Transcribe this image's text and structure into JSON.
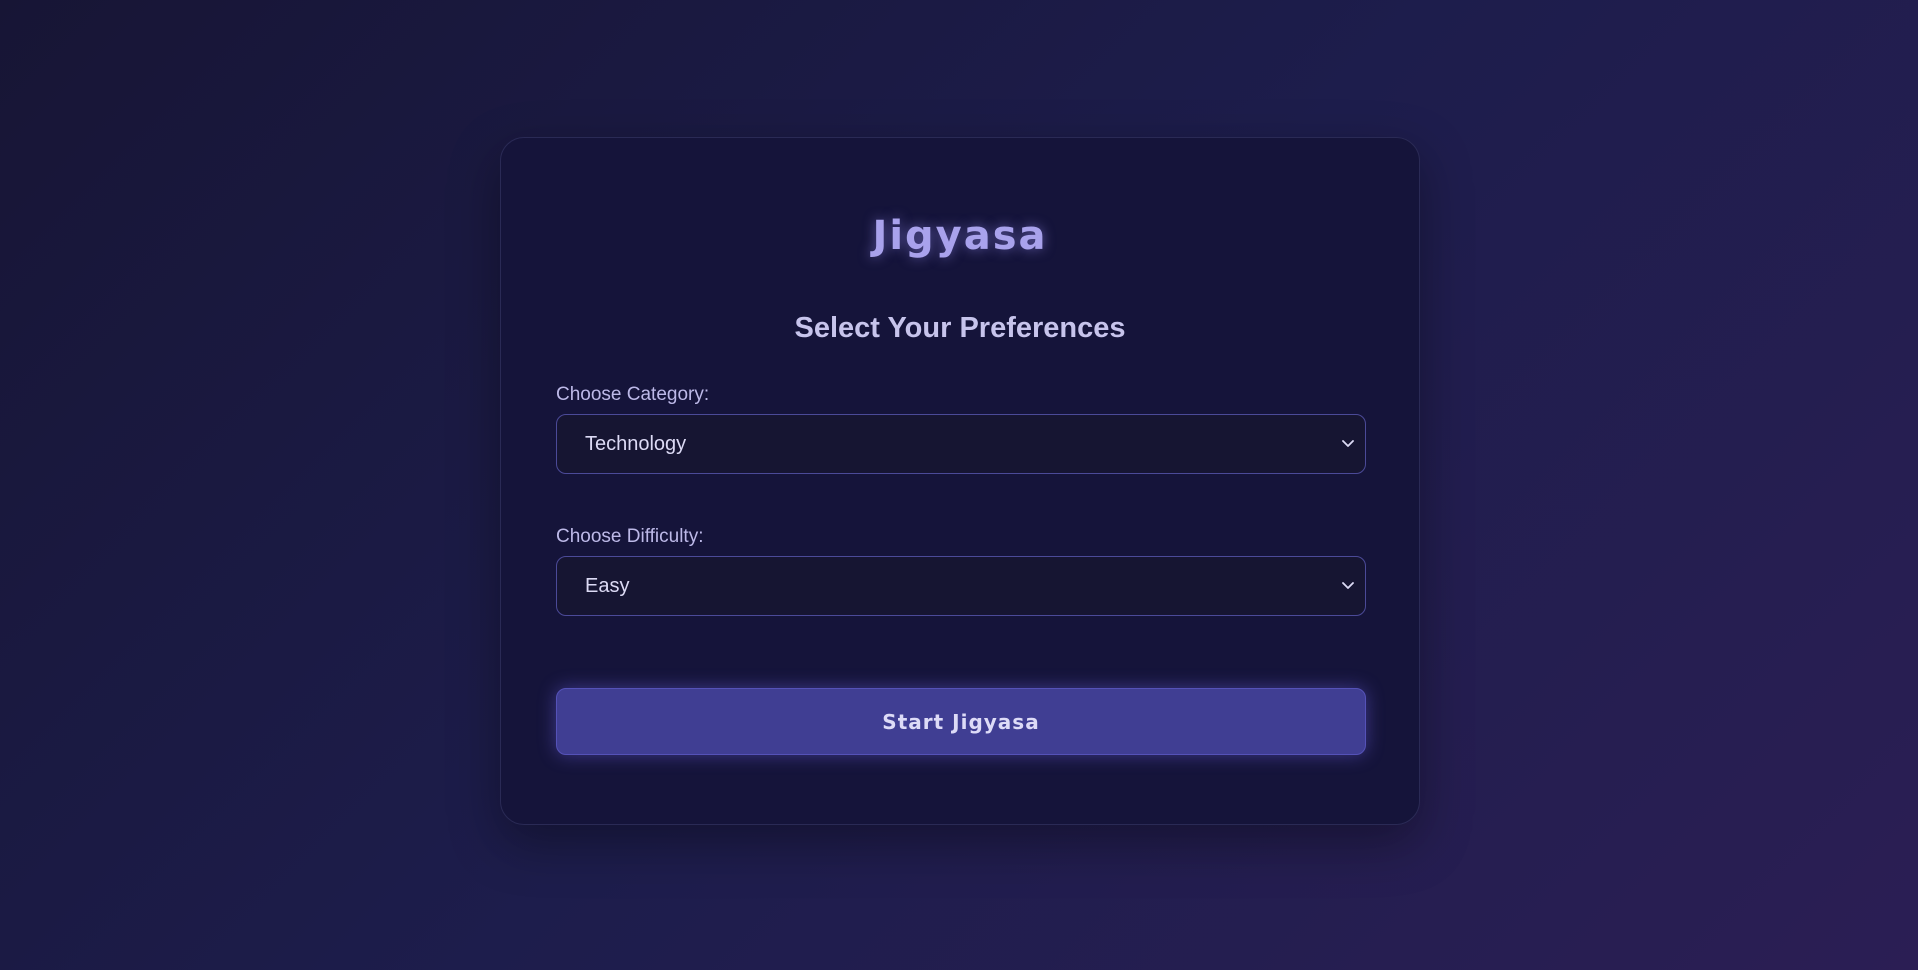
{
  "app": {
    "title": "Jigyasa"
  },
  "form": {
    "heading": "Select Your Preferences",
    "category": {
      "label": "Choose Category:",
      "selected": "Technology"
    },
    "difficulty": {
      "label": "Choose Difficulty:",
      "selected": "Easy"
    },
    "submit_label": "Start Jigyasa"
  },
  "icons": {
    "select_indicator": "chevron-down-icon"
  },
  "colors": {
    "accent": "#403e93",
    "title": "#a9a2ec",
    "card_background": "#15143a"
  }
}
